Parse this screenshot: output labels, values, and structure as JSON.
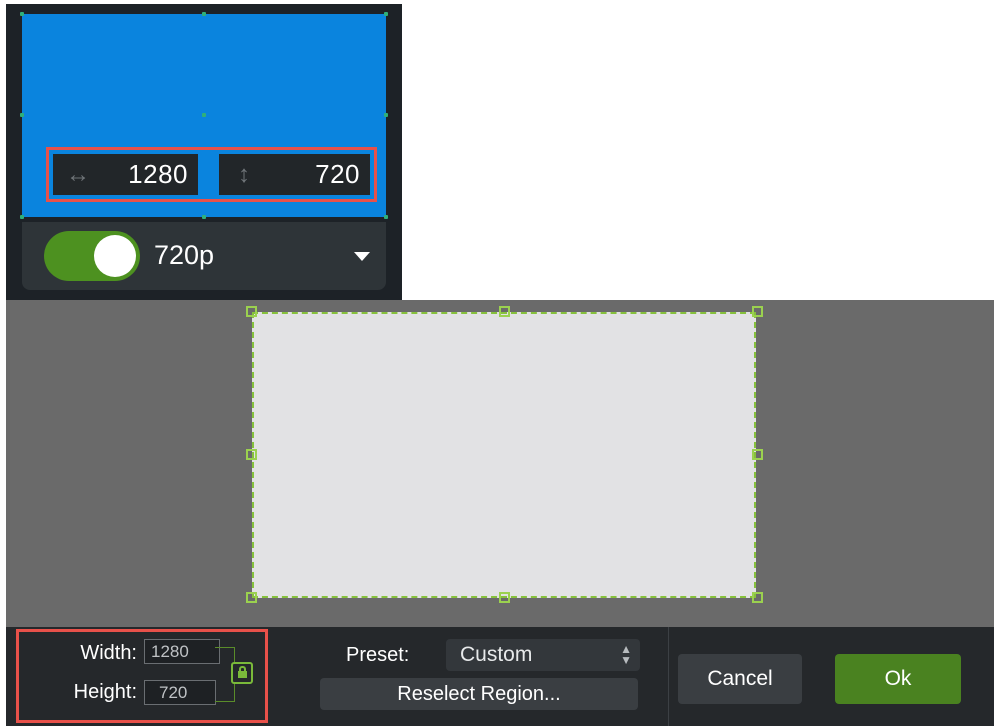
{
  "recorder": {
    "width_value": "1280",
    "height_value": "720",
    "width_icon": "horizontal-arrows-icon",
    "height_icon": "vertical-arrows-icon",
    "resolution_label": "720p",
    "toggle_on": true,
    "highlight_color": "#e8514a",
    "region_color": "#0a84de"
  },
  "capture": {
    "width_label": "Width:",
    "width_value": "1280",
    "height_label": "Height:",
    "height_value": "720",
    "lock_icon": "lock-icon",
    "preset_label": "Preset:",
    "preset_value": "Custom",
    "reselect_label": "Reselect Region...",
    "cancel_label": "Cancel",
    "ok_label": "Ok",
    "accent_color": "#4a8220"
  }
}
